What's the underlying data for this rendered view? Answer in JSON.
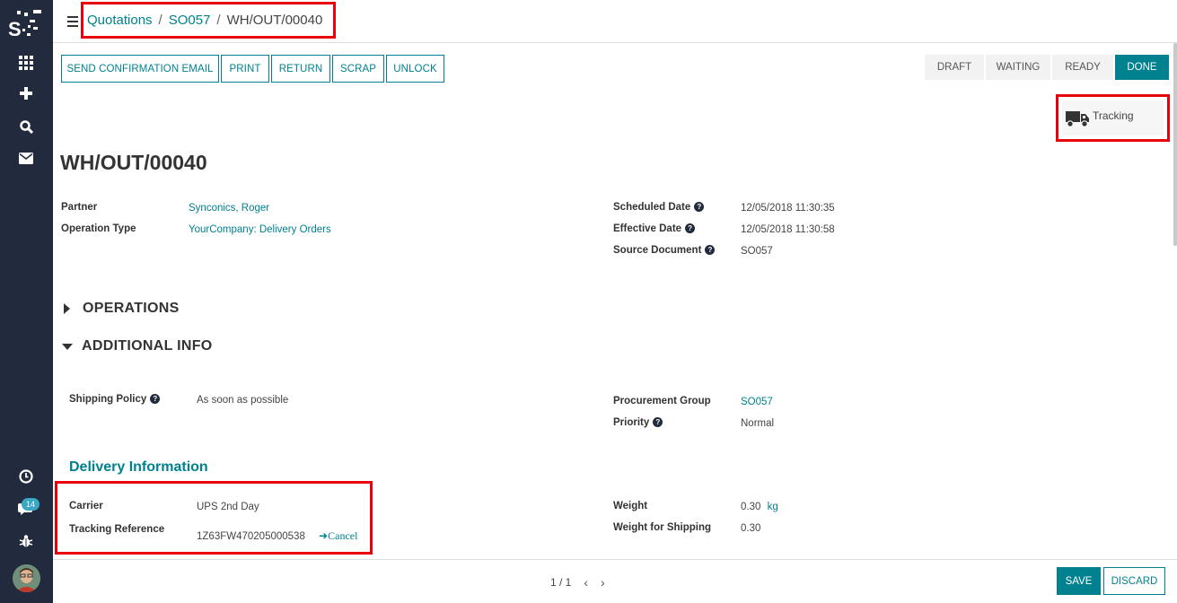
{
  "sidebar": {
    "icons": [
      "logo-icon",
      "apps-grid-icon",
      "plus-icon",
      "search-icon",
      "mail-icon",
      "clock-icon",
      "chat-icon",
      "bug-icon"
    ],
    "messages_badge": "14"
  },
  "breadcrumb": {
    "items": [
      "Quotations",
      "SO057"
    ],
    "separator": "/",
    "current": "WH/OUT/00040"
  },
  "actions": {
    "send_confirmation_email": "SEND CONFIRMATION EMAIL",
    "print": "PRINT",
    "return": "RETURN",
    "scrap": "SCRAP",
    "unlock": "UNLOCK"
  },
  "status": {
    "stages": [
      "DRAFT",
      "WAITING",
      "READY",
      "DONE"
    ],
    "active": "DONE"
  },
  "smart_button": {
    "label": "Tracking",
    "icon": "truck-icon"
  },
  "record": {
    "title": "WH/OUT/00040",
    "partner_label": "Partner",
    "partner": "Synconics, Roger",
    "operation_type_label": "Operation Type",
    "operation_type": "YourCompany: Delivery Orders",
    "scheduled_date_label": "Scheduled Date",
    "scheduled_date": "12/05/2018 11:30:35",
    "effective_date_label": "Effective Date",
    "effective_date": "12/05/2018 11:30:58",
    "source_document_label": "Source Document",
    "source_document": "SO057"
  },
  "sections": {
    "operations": "OPERATIONS",
    "additional_info": "ADDITIONAL INFO"
  },
  "additional": {
    "shipping_policy_label": "Shipping Policy",
    "shipping_policy": "As soon as possible",
    "procurement_group_label": "Procurement Group",
    "procurement_group": "SO057",
    "priority_label": "Priority",
    "priority": "Normal"
  },
  "delivery": {
    "heading": "Delivery Information",
    "carrier_label": "Carrier",
    "carrier": "UPS 2nd Day",
    "tracking_ref_label": "Tracking Reference",
    "tracking_ref": "1Z63FW470205000538",
    "cancel_label": "Cancel",
    "weight_label": "Weight",
    "weight": "0.30",
    "weight_unit": "kg",
    "weight_shipping_label": "Weight for Shipping",
    "weight_shipping": "0.30"
  },
  "pager": {
    "text": "1 / 1",
    "prev": "‹",
    "next": "›"
  },
  "footer": {
    "save": "SAVE",
    "discard": "DISCARD"
  },
  "colors": {
    "sidebar": "#212b3d",
    "accent": "#00818f",
    "highlight": "#e8000b"
  }
}
